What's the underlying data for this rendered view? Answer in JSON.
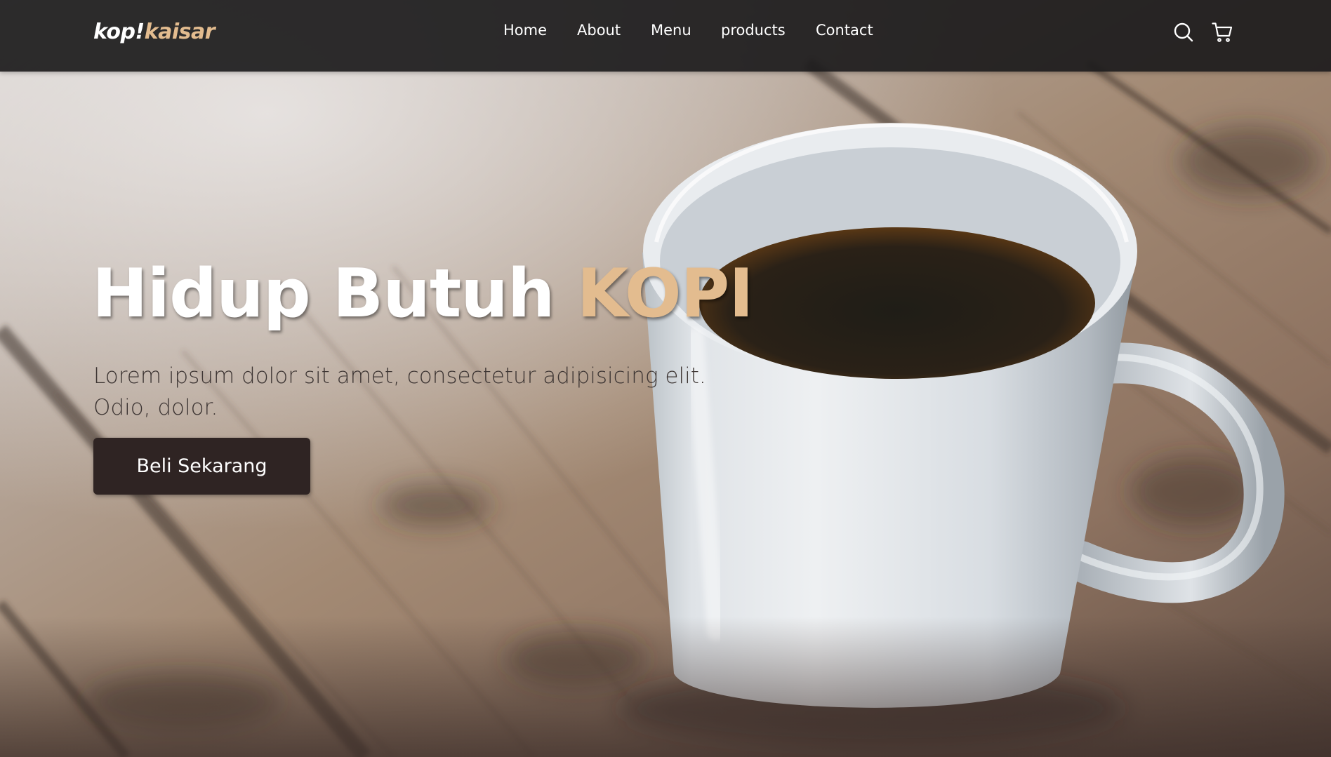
{
  "theme": {
    "accent": "#e3bc8f",
    "navbar_bg": "#1c1b1c",
    "button_bg": "#2f2423",
    "text_light": "#ffffff"
  },
  "navbar": {
    "logo_main": "kop!",
    "logo_accent": "kaisar",
    "links": [
      {
        "label": "Home"
      },
      {
        "label": "About"
      },
      {
        "label": "Menu"
      },
      {
        "label": "products"
      },
      {
        "label": "Contact"
      }
    ],
    "icons": [
      "search-icon",
      "shopping-cart-icon"
    ]
  },
  "hero": {
    "title_main": "Hidup Butuh",
    "title_accent": "KOPI",
    "description": "Lorem ipsum dolor sit amet, consectetur adipisicing elit. Odio, dolor.",
    "cta_label": "Beli Sekarang"
  }
}
